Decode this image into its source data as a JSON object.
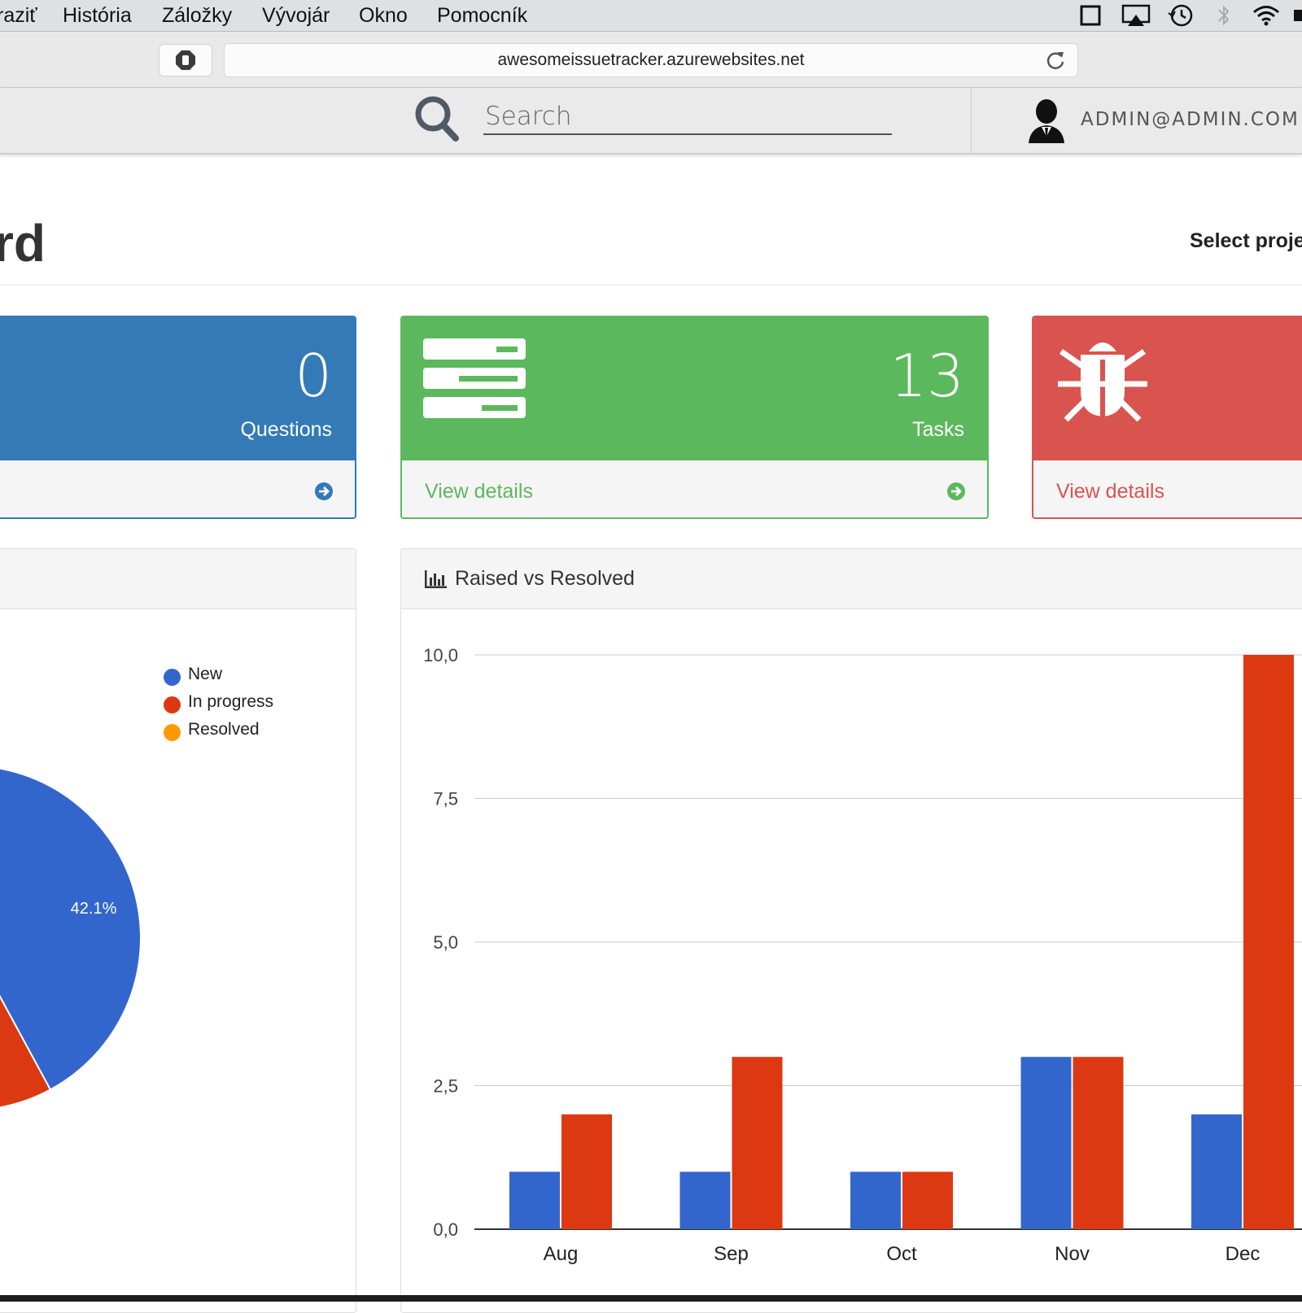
{
  "menubar": {
    "items": [
      "raziť",
      "História",
      "Záložky",
      "Vývojár",
      "Okno",
      "Pomocník"
    ]
  },
  "browser": {
    "url": "awesomeissuetracker.azurewebsites.net"
  },
  "navbar": {
    "search_placeholder": "Search",
    "user": "ADMIN@ADMIN.COM"
  },
  "page": {
    "title": "rd",
    "select_project": "Select proje"
  },
  "stats": {
    "questions": {
      "count": "0",
      "label": "Questions"
    },
    "tasks": {
      "count": "13",
      "label": "Tasks",
      "details": "View details"
    },
    "bugs": {
      "details": "View details"
    }
  },
  "colors": {
    "blue": "#3366cc",
    "red": "#dc3912",
    "orange": "#ff9900",
    "panel_blue": "#337ab7",
    "panel_green": "#5cb85c",
    "panel_red": "#d9534f"
  },
  "pie_panel": {
    "legend": [
      {
        "label": "New",
        "color": "#3366cc"
      },
      {
        "label": "In progress",
        "color": "#dc3912"
      },
      {
        "label": "Resolved",
        "color": "#ff9900"
      }
    ],
    "slice_label": "42.1%"
  },
  "bar_panel": {
    "title": "Raised vs Resolved"
  },
  "chart_data": [
    {
      "type": "pie",
      "labels": [
        "New",
        "In progress",
        "Resolved"
      ],
      "values": [
        42.1
      ],
      "visible_data_labels": [
        "42.1%"
      ],
      "legend": "top-right"
    },
    {
      "type": "bar",
      "title": "Raised vs Resolved",
      "categories": [
        "Aug",
        "Sep",
        "Oct",
        "Nov",
        "Dec"
      ],
      "series": [
        {
          "values": [
            1,
            1,
            1,
            3,
            2
          ],
          "color": "#3366cc"
        },
        {
          "values": [
            2,
            3,
            1,
            3,
            10
          ],
          "color": "#dc3912"
        }
      ],
      "ylim": [
        0,
        10
      ],
      "yticks": [
        "0,0",
        "2,5",
        "5,0",
        "7,5",
        "10,0"
      ],
      "grid": true
    }
  ]
}
